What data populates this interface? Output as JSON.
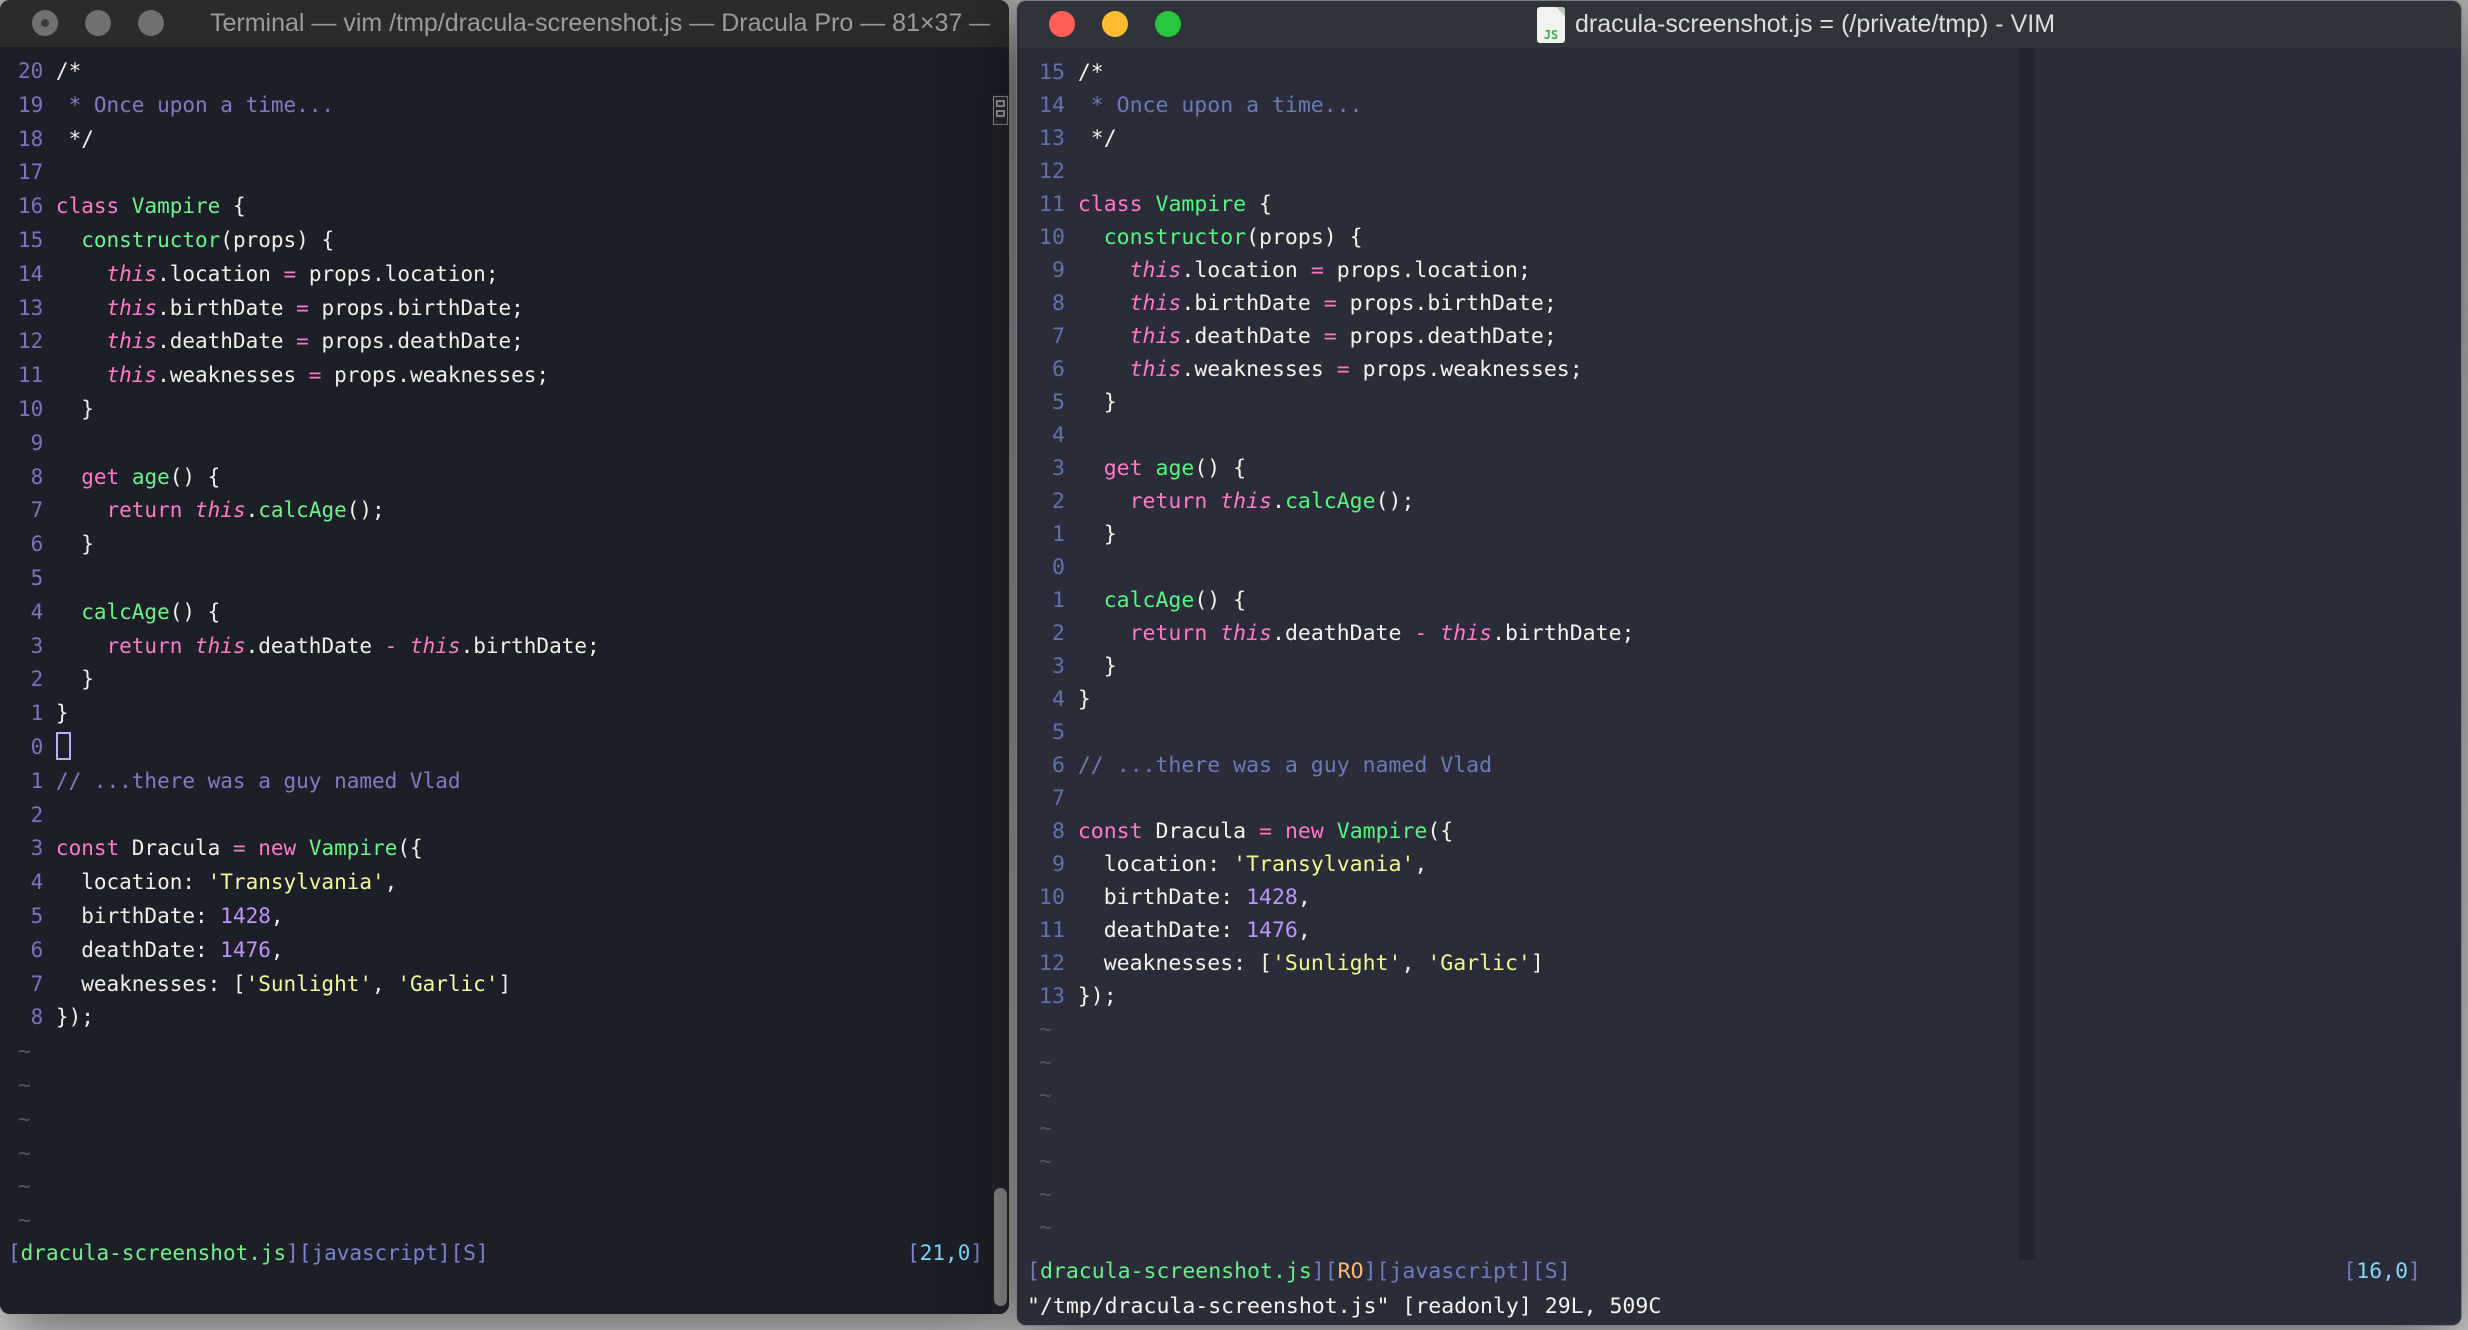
{
  "left_window": {
    "title": "Terminal — vim /tmp/dracula-screenshot.js — Dracula Pro — 81×37 —…",
    "tilde": "~",
    "tilde_count": 6,
    "lines": [
      {
        "n": "20",
        "t": [
          [
            "fg",
            "/*"
          ]
        ]
      },
      {
        "n": "19",
        "t": [
          [
            "cm",
            " * Once upon a time..."
          ]
        ]
      },
      {
        "n": "18",
        "t": [
          [
            "fg",
            " */"
          ]
        ]
      },
      {
        "n": "17",
        "t": []
      },
      {
        "n": "16",
        "t": [
          [
            "pk",
            "class"
          ],
          [
            "fg",
            " "
          ],
          [
            "gr",
            "Vampire"
          ],
          [
            "fg",
            " {"
          ]
        ]
      },
      {
        "n": "15",
        "t": [
          [
            "fg",
            "  "
          ],
          [
            "gr",
            "constructor"
          ],
          [
            "fg",
            "(props) {"
          ]
        ]
      },
      {
        "n": "14",
        "t": [
          [
            "fg",
            "    "
          ],
          [
            "th",
            "this"
          ],
          [
            "fg",
            ".location "
          ],
          [
            "pk",
            "="
          ],
          [
            "fg",
            " props.location;"
          ]
        ]
      },
      {
        "n": "13",
        "t": [
          [
            "fg",
            "    "
          ],
          [
            "th",
            "this"
          ],
          [
            "fg",
            ".birthDate "
          ],
          [
            "pk",
            "="
          ],
          [
            "fg",
            " props.birthDate;"
          ]
        ]
      },
      {
        "n": "12",
        "t": [
          [
            "fg",
            "    "
          ],
          [
            "th",
            "this"
          ],
          [
            "fg",
            ".deathDate "
          ],
          [
            "pk",
            "="
          ],
          [
            "fg",
            " props.deathDate;"
          ]
        ]
      },
      {
        "n": "11",
        "t": [
          [
            "fg",
            "    "
          ],
          [
            "th",
            "this"
          ],
          [
            "fg",
            ".weaknesses "
          ],
          [
            "pk",
            "="
          ],
          [
            "fg",
            " props.weaknesses;"
          ]
        ]
      },
      {
        "n": "10",
        "t": [
          [
            "fg",
            "  }"
          ]
        ]
      },
      {
        "n": " 9",
        "t": []
      },
      {
        "n": " 8",
        "t": [
          [
            "fg",
            "  "
          ],
          [
            "pk",
            "get"
          ],
          [
            "fg",
            " "
          ],
          [
            "gr",
            "age"
          ],
          [
            "fg",
            "() {"
          ]
        ]
      },
      {
        "n": " 7",
        "t": [
          [
            "fg",
            "    "
          ],
          [
            "pk",
            "return"
          ],
          [
            "fg",
            " "
          ],
          [
            "th",
            "this"
          ],
          [
            "fg",
            "."
          ],
          [
            "gr",
            "calcAge"
          ],
          [
            "fg",
            "();"
          ]
        ]
      },
      {
        "n": " 6",
        "t": [
          [
            "fg",
            "  }"
          ]
        ]
      },
      {
        "n": " 5",
        "t": []
      },
      {
        "n": " 4",
        "t": [
          [
            "fg",
            "  "
          ],
          [
            "gr",
            "calcAge"
          ],
          [
            "fg",
            "() {"
          ]
        ]
      },
      {
        "n": " 3",
        "t": [
          [
            "fg",
            "    "
          ],
          [
            "pk",
            "return"
          ],
          [
            "fg",
            " "
          ],
          [
            "th",
            "this"
          ],
          [
            "fg",
            ".deathDate "
          ],
          [
            "pk",
            "-"
          ],
          [
            "fg",
            " "
          ],
          [
            "th",
            "this"
          ],
          [
            "fg",
            ".birthDate;"
          ]
        ]
      },
      {
        "n": " 2",
        "t": [
          [
            "fg",
            "  }"
          ]
        ]
      },
      {
        "n": " 1",
        "t": [
          [
            "fg",
            "}"
          ]
        ]
      },
      {
        "n": " 0",
        "t": [
          [
            "cur",
            " "
          ]
        ]
      },
      {
        "n": " 1",
        "t": [
          [
            "cm",
            "// ...there was a guy named Vlad"
          ]
        ]
      },
      {
        "n": " 2",
        "t": []
      },
      {
        "n": " 3",
        "t": [
          [
            "pk",
            "const"
          ],
          [
            "fg",
            " Dracula "
          ],
          [
            "pk",
            "="
          ],
          [
            "fg",
            " "
          ],
          [
            "pk",
            "new"
          ],
          [
            "fg",
            " "
          ],
          [
            "gr",
            "Vampire"
          ],
          [
            "fg",
            "({"
          ]
        ]
      },
      {
        "n": " 4",
        "t": [
          [
            "fg",
            "  location: "
          ],
          [
            "yl",
            "'Transylvania'"
          ],
          [
            "fg",
            ","
          ]
        ]
      },
      {
        "n": " 5",
        "t": [
          [
            "fg",
            "  birthDate: "
          ],
          [
            "pu",
            "1428"
          ],
          [
            "fg",
            ","
          ]
        ]
      },
      {
        "n": " 6",
        "t": [
          [
            "fg",
            "  deathDate: "
          ],
          [
            "pu",
            "1476"
          ],
          [
            "fg",
            ","
          ]
        ]
      },
      {
        "n": " 7",
        "t": [
          [
            "fg",
            "  weaknesses: ["
          ],
          [
            "yl",
            "'Sunlight'"
          ],
          [
            "fg",
            ", "
          ],
          [
            "yl",
            "'Garlic'"
          ],
          [
            "fg",
            "]"
          ]
        ]
      },
      {
        "n": " 8",
        "t": [
          [
            "fg",
            "});"
          ]
        ]
      }
    ],
    "status": {
      "left": [
        [
          "br",
          "["
        ],
        [
          "file",
          "dracula-screenshot.js"
        ],
        [
          "br",
          "]["
        ],
        [
          "lbl",
          "javascript"
        ],
        [
          "br",
          "]["
        ],
        [
          "lbl",
          "S"
        ],
        [
          "br",
          "]"
        ]
      ],
      "right": [
        [
          "br",
          "["
        ],
        [
          "cy",
          "21,0"
        ],
        [
          "br",
          "]"
        ]
      ]
    }
  },
  "right_window": {
    "title": "dracula-screenshot.js = (/private/tmp) - VIM",
    "file_icon_label": "JS",
    "tilde": "~",
    "tilde_count": 7,
    "lines": [
      {
        "n": "15",
        "t": [
          [
            "fg",
            "/*"
          ]
        ]
      },
      {
        "n": "14",
        "t": [
          [
            "cm",
            " * Once upon a time..."
          ]
        ]
      },
      {
        "n": "13",
        "t": [
          [
            "fg",
            " */"
          ]
        ]
      },
      {
        "n": "12",
        "t": []
      },
      {
        "n": "11",
        "t": [
          [
            "pk",
            "class"
          ],
          [
            "fg",
            " "
          ],
          [
            "gr",
            "Vampire"
          ],
          [
            "fg",
            " {"
          ]
        ]
      },
      {
        "n": "10",
        "t": [
          [
            "fg",
            "  "
          ],
          [
            "gr",
            "constructor"
          ],
          [
            "fg",
            "(props) {"
          ]
        ]
      },
      {
        "n": " 9",
        "t": [
          [
            "fg",
            "    "
          ],
          [
            "th",
            "this"
          ],
          [
            "fg",
            ".location "
          ],
          [
            "pk",
            "="
          ],
          [
            "fg",
            " props.location;"
          ]
        ]
      },
      {
        "n": " 8",
        "t": [
          [
            "fg",
            "    "
          ],
          [
            "th",
            "this"
          ],
          [
            "fg",
            ".birthDate "
          ],
          [
            "pk",
            "="
          ],
          [
            "fg",
            " props.birthDate;"
          ]
        ]
      },
      {
        "n": " 7",
        "t": [
          [
            "fg",
            "    "
          ],
          [
            "th",
            "this"
          ],
          [
            "fg",
            ".deathDate "
          ],
          [
            "pk",
            "="
          ],
          [
            "fg",
            " props.deathDate;"
          ]
        ]
      },
      {
        "n": " 6",
        "t": [
          [
            "fg",
            "    "
          ],
          [
            "th",
            "this"
          ],
          [
            "fg",
            ".weaknesses "
          ],
          [
            "pk",
            "="
          ],
          [
            "fg",
            " props.weaknesses;"
          ]
        ]
      },
      {
        "n": " 5",
        "t": [
          [
            "fg",
            "  }"
          ]
        ]
      },
      {
        "n": " 4",
        "t": []
      },
      {
        "n": " 3",
        "t": [
          [
            "fg",
            "  "
          ],
          [
            "pk",
            "get"
          ],
          [
            "fg",
            " "
          ],
          [
            "gr",
            "age"
          ],
          [
            "fg",
            "() {"
          ]
        ]
      },
      {
        "n": " 2",
        "t": [
          [
            "fg",
            "    "
          ],
          [
            "pk",
            "return"
          ],
          [
            "fg",
            " "
          ],
          [
            "th",
            "this"
          ],
          [
            "fg",
            "."
          ],
          [
            "gr",
            "calcAge"
          ],
          [
            "fg",
            "();"
          ]
        ]
      },
      {
        "n": " 1",
        "t": [
          [
            "fg",
            "  }"
          ]
        ]
      },
      {
        "n": " 0",
        "t": []
      },
      {
        "n": " 1",
        "t": [
          [
            "fg",
            "  "
          ],
          [
            "gr",
            "calcAge"
          ],
          [
            "fg",
            "() {"
          ]
        ]
      },
      {
        "n": " 2",
        "t": [
          [
            "fg",
            "    "
          ],
          [
            "pk",
            "return"
          ],
          [
            "fg",
            " "
          ],
          [
            "th",
            "this"
          ],
          [
            "fg",
            ".deathDate "
          ],
          [
            "pk",
            "-"
          ],
          [
            "fg",
            " "
          ],
          [
            "th",
            "this"
          ],
          [
            "fg",
            ".birthDate;"
          ]
        ]
      },
      {
        "n": " 3",
        "t": [
          [
            "fg",
            "  }"
          ]
        ]
      },
      {
        "n": " 4",
        "t": [
          [
            "fg",
            "}"
          ]
        ]
      },
      {
        "n": " 5",
        "t": []
      },
      {
        "n": " 6",
        "t": [
          [
            "cm",
            "// ...there was a guy named Vlad"
          ]
        ]
      },
      {
        "n": " 7",
        "t": []
      },
      {
        "n": " 8",
        "t": [
          [
            "pk",
            "const"
          ],
          [
            "fg",
            " Dracula "
          ],
          [
            "pk",
            "="
          ],
          [
            "fg",
            " "
          ],
          [
            "pk",
            "new"
          ],
          [
            "fg",
            " "
          ],
          [
            "gr",
            "Vampire"
          ],
          [
            "fg",
            "({"
          ]
        ]
      },
      {
        "n": " 9",
        "t": [
          [
            "fg",
            "  location: "
          ],
          [
            "yl",
            "'Transylvania'"
          ],
          [
            "fg",
            ","
          ]
        ]
      },
      {
        "n": "10",
        "t": [
          [
            "fg",
            "  birthDate: "
          ],
          [
            "pu",
            "1428"
          ],
          [
            "fg",
            ","
          ]
        ]
      },
      {
        "n": "11",
        "t": [
          [
            "fg",
            "  deathDate: "
          ],
          [
            "pu",
            "1476"
          ],
          [
            "fg",
            ","
          ]
        ]
      },
      {
        "n": "12",
        "t": [
          [
            "fg",
            "  weaknesses: ["
          ],
          [
            "yl",
            "'Sunlight'"
          ],
          [
            "fg",
            ", "
          ],
          [
            "yl",
            "'Garlic'"
          ],
          [
            "fg",
            "]"
          ]
        ]
      },
      {
        "n": "13",
        "t": [
          [
            "fg",
            "});"
          ]
        ]
      }
    ],
    "status": {
      "left": [
        [
          "br",
          "["
        ],
        [
          "file",
          "dracula-screenshot.js"
        ],
        [
          "br",
          "]["
        ],
        [
          "ro",
          "RO"
        ],
        [
          "br",
          "]["
        ],
        [
          "lbl",
          "javascript"
        ],
        [
          "br",
          "]["
        ],
        [
          "lbl",
          "S"
        ],
        [
          "br",
          "]"
        ]
      ],
      "right": [
        [
          "br",
          "["
        ],
        [
          "cy",
          "16,0"
        ],
        [
          "br",
          "]"
        ]
      ]
    },
    "command_line": "\"/tmp/dracula-screenshot.js\" [readonly] 29L, 509C"
  }
}
